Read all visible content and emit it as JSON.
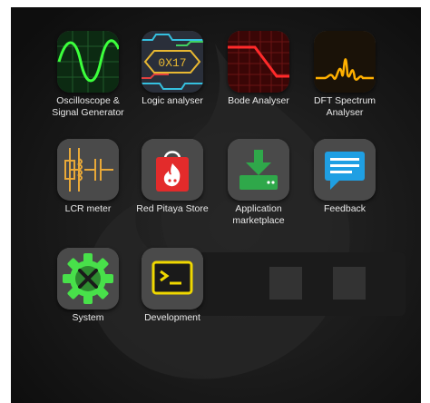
{
  "apps": [
    {
      "label": "Oscilloscope & Signal Generator",
      "icon": "oscilloscope-icon"
    },
    {
      "label": "Logic analyser",
      "icon": "logic-analyser-icon",
      "icon_text": "0X17"
    },
    {
      "label": "Bode Analyser",
      "icon": "bode-plot-icon"
    },
    {
      "label": "DFT Spectrum Analyser",
      "icon": "spectrum-icon"
    },
    {
      "label": "LCR meter",
      "icon": "lcr-circuit-icon"
    },
    {
      "label": "Red Pitaya Store",
      "icon": "store-bag-icon"
    },
    {
      "label": "Application marketplace",
      "icon": "download-icon"
    },
    {
      "label": "Feedback",
      "icon": "chat-bubble-icon"
    },
    {
      "label": "System",
      "icon": "settings-tools-icon"
    },
    {
      "label": "Development",
      "icon": "terminal-icon"
    }
  ],
  "colors": {
    "oscilloscope_trace": "#3cff3c",
    "logic_trace": "#e8b832",
    "bode_trace": "#ff2a2a",
    "spectrum_trace": "#ffb000",
    "store_red": "#e32b2b",
    "marketplace_green": "#2fa84a",
    "feedback_blue": "#1f9fe3",
    "system_green": "#48e04a",
    "dev_yellow": "#f0d800"
  }
}
